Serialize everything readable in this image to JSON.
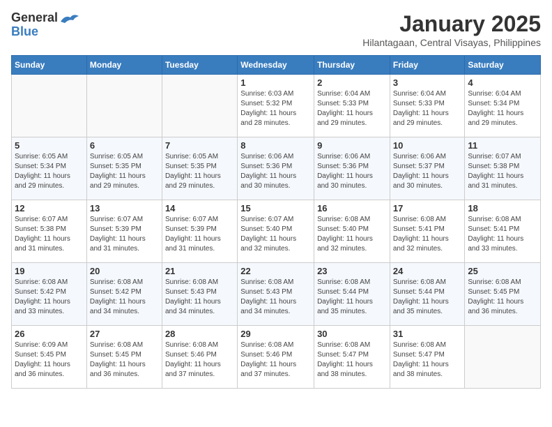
{
  "header": {
    "logo_general": "General",
    "logo_blue": "Blue",
    "month_title": "January 2025",
    "location": "Hilantagaan, Central Visayas, Philippines"
  },
  "weekdays": [
    "Sunday",
    "Monday",
    "Tuesday",
    "Wednesday",
    "Thursday",
    "Friday",
    "Saturday"
  ],
  "weeks": [
    [
      {
        "day": "",
        "info": ""
      },
      {
        "day": "",
        "info": ""
      },
      {
        "day": "",
        "info": ""
      },
      {
        "day": "1",
        "info": "Sunrise: 6:03 AM\nSunset: 5:32 PM\nDaylight: 11 hours\nand 28 minutes."
      },
      {
        "day": "2",
        "info": "Sunrise: 6:04 AM\nSunset: 5:33 PM\nDaylight: 11 hours\nand 29 minutes."
      },
      {
        "day": "3",
        "info": "Sunrise: 6:04 AM\nSunset: 5:33 PM\nDaylight: 11 hours\nand 29 minutes."
      },
      {
        "day": "4",
        "info": "Sunrise: 6:04 AM\nSunset: 5:34 PM\nDaylight: 11 hours\nand 29 minutes."
      }
    ],
    [
      {
        "day": "5",
        "info": "Sunrise: 6:05 AM\nSunset: 5:34 PM\nDaylight: 11 hours\nand 29 minutes."
      },
      {
        "day": "6",
        "info": "Sunrise: 6:05 AM\nSunset: 5:35 PM\nDaylight: 11 hours\nand 29 minutes."
      },
      {
        "day": "7",
        "info": "Sunrise: 6:05 AM\nSunset: 5:35 PM\nDaylight: 11 hours\nand 29 minutes."
      },
      {
        "day": "8",
        "info": "Sunrise: 6:06 AM\nSunset: 5:36 PM\nDaylight: 11 hours\nand 30 minutes."
      },
      {
        "day": "9",
        "info": "Sunrise: 6:06 AM\nSunset: 5:36 PM\nDaylight: 11 hours\nand 30 minutes."
      },
      {
        "day": "10",
        "info": "Sunrise: 6:06 AM\nSunset: 5:37 PM\nDaylight: 11 hours\nand 30 minutes."
      },
      {
        "day": "11",
        "info": "Sunrise: 6:07 AM\nSunset: 5:38 PM\nDaylight: 11 hours\nand 31 minutes."
      }
    ],
    [
      {
        "day": "12",
        "info": "Sunrise: 6:07 AM\nSunset: 5:38 PM\nDaylight: 11 hours\nand 31 minutes."
      },
      {
        "day": "13",
        "info": "Sunrise: 6:07 AM\nSunset: 5:39 PM\nDaylight: 11 hours\nand 31 minutes."
      },
      {
        "day": "14",
        "info": "Sunrise: 6:07 AM\nSunset: 5:39 PM\nDaylight: 11 hours\nand 31 minutes."
      },
      {
        "day": "15",
        "info": "Sunrise: 6:07 AM\nSunset: 5:40 PM\nDaylight: 11 hours\nand 32 minutes."
      },
      {
        "day": "16",
        "info": "Sunrise: 6:08 AM\nSunset: 5:40 PM\nDaylight: 11 hours\nand 32 minutes."
      },
      {
        "day": "17",
        "info": "Sunrise: 6:08 AM\nSunset: 5:41 PM\nDaylight: 11 hours\nand 32 minutes."
      },
      {
        "day": "18",
        "info": "Sunrise: 6:08 AM\nSunset: 5:41 PM\nDaylight: 11 hours\nand 33 minutes."
      }
    ],
    [
      {
        "day": "19",
        "info": "Sunrise: 6:08 AM\nSunset: 5:42 PM\nDaylight: 11 hours\nand 33 minutes."
      },
      {
        "day": "20",
        "info": "Sunrise: 6:08 AM\nSunset: 5:42 PM\nDaylight: 11 hours\nand 34 minutes."
      },
      {
        "day": "21",
        "info": "Sunrise: 6:08 AM\nSunset: 5:43 PM\nDaylight: 11 hours\nand 34 minutes."
      },
      {
        "day": "22",
        "info": "Sunrise: 6:08 AM\nSunset: 5:43 PM\nDaylight: 11 hours\nand 34 minutes."
      },
      {
        "day": "23",
        "info": "Sunrise: 6:08 AM\nSunset: 5:44 PM\nDaylight: 11 hours\nand 35 minutes."
      },
      {
        "day": "24",
        "info": "Sunrise: 6:08 AM\nSunset: 5:44 PM\nDaylight: 11 hours\nand 35 minutes."
      },
      {
        "day": "25",
        "info": "Sunrise: 6:08 AM\nSunset: 5:45 PM\nDaylight: 11 hours\nand 36 minutes."
      }
    ],
    [
      {
        "day": "26",
        "info": "Sunrise: 6:09 AM\nSunset: 5:45 PM\nDaylight: 11 hours\nand 36 minutes."
      },
      {
        "day": "27",
        "info": "Sunrise: 6:08 AM\nSunset: 5:45 PM\nDaylight: 11 hours\nand 36 minutes."
      },
      {
        "day": "28",
        "info": "Sunrise: 6:08 AM\nSunset: 5:46 PM\nDaylight: 11 hours\nand 37 minutes."
      },
      {
        "day": "29",
        "info": "Sunrise: 6:08 AM\nSunset: 5:46 PM\nDaylight: 11 hours\nand 37 minutes."
      },
      {
        "day": "30",
        "info": "Sunrise: 6:08 AM\nSunset: 5:47 PM\nDaylight: 11 hours\nand 38 minutes."
      },
      {
        "day": "31",
        "info": "Sunrise: 6:08 AM\nSunset: 5:47 PM\nDaylight: 11 hours\nand 38 minutes."
      },
      {
        "day": "",
        "info": ""
      }
    ]
  ]
}
